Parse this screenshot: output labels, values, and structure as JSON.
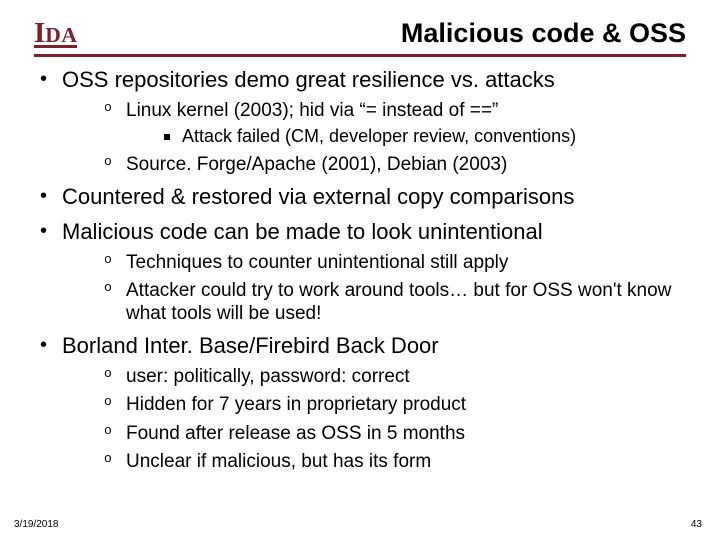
{
  "header": {
    "logo": "IDA",
    "title": "Malicious code & OSS"
  },
  "bullets": {
    "b1": "OSS repositories demo great resilience vs. attacks",
    "b1a": "Linux kernel (2003); hid via “= instead of ==”",
    "b1a1": "Attack failed (CM, developer review, conventions)",
    "b1b": "Source. Forge/Apache (2001), Debian (2003)",
    "b2": "Countered & restored via external copy comparisons",
    "b3": "Malicious code can be made to look unintentional",
    "b3a": "Techniques to counter unintentional still apply",
    "b3b": "Attacker could try to work around tools… but for OSS won't know what tools will be used!",
    "b4": "Borland Inter. Base/Firebird Back Door",
    "b4a": "user: politically, password: correct",
    "b4b": "Hidden for 7 years in proprietary product",
    "b4c": "Found after release as OSS in 5 months",
    "b4d": "Unclear if malicious, but has its form"
  },
  "footer": {
    "date": "3/19/2018",
    "page": "43"
  }
}
